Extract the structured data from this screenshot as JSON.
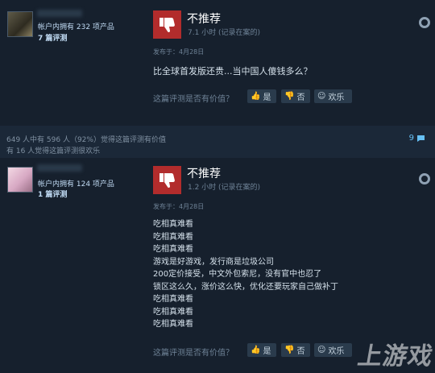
{
  "reviews": [
    {
      "owned": "帐户内拥有 232 项产品",
      "review_count": "7 篇评测",
      "verdict": "不推荐",
      "hours": "7.1 小时   (记录在案的)",
      "posted": "发布于：4月28日",
      "text": "比全球首发版还贵...当中国人傻钱多么？",
      "vote_question": "这篇评测是否有价值？",
      "yes_label": "是",
      "no_label": "否",
      "funny_label": "欢乐"
    },
    {
      "owned": "帐户内拥有 124 项产品",
      "review_count": "1 篇评测",
      "verdict": "不推荐",
      "hours": "1.2 小时   (记录在案的)",
      "posted": "发布于：4月28日",
      "lines": [
        "吃相真难看",
        "吃相真难看",
        "吃相真难看",
        "游戏是好游戏，发行商是垃圾公司",
        "200定价接受，中文外包索尼，没有官中也忍了",
        "锁区这么久，涨价这么快，优化还要玩家自己做补丁",
        "吃相真难看",
        "吃相真难看",
        "吃相真难看"
      ],
      "vote_question": "这篇评测是否有价值？",
      "yes_label": "是",
      "no_label": "否",
      "funny_label": "欢乐"
    }
  ],
  "helpful_summary": "649 人中有 596 人（92%）觉得这篇评测有价值",
  "funny_summary": "有 16 人觉得这篇评测很欢乐",
  "comment_count": "9",
  "watermark": "上游戏"
}
